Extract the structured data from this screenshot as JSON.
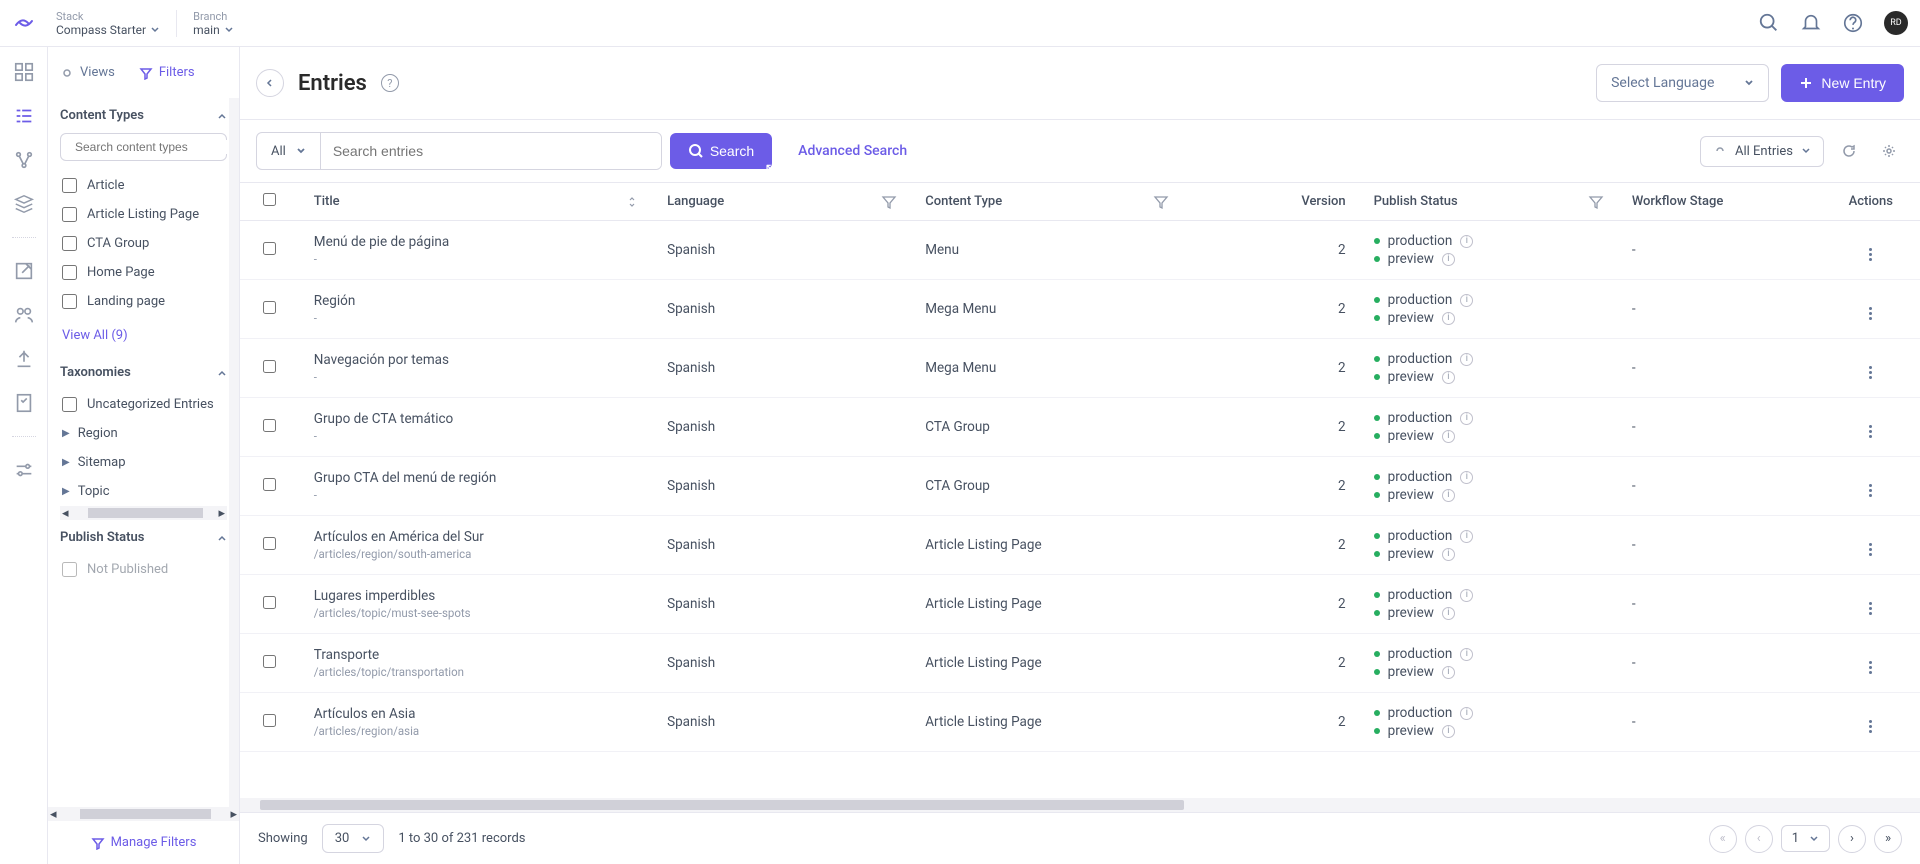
{
  "colors": {
    "accent": "#6c5ce7",
    "green": "#27ae60"
  },
  "topbar": {
    "stack_label": "Stack",
    "stack_value": "Compass Starter",
    "branch_label": "Branch",
    "branch_value": "main",
    "avatar": "RD"
  },
  "sidebar": {
    "views_label": "Views",
    "filters_label": "Filters",
    "content_types_label": "Content Types",
    "search_placeholder": "Search content types",
    "content_types": [
      "Article",
      "Article Listing Page",
      "CTA Group",
      "Home Page",
      "Landing page"
    ],
    "view_all_label": "View All (9)",
    "taxonomies_label": "Taxonomies",
    "uncategorized_label": "Uncategorized Entries",
    "taxonomies": [
      "Region",
      "Sitemap",
      "Topic"
    ],
    "publish_status_label": "Publish Status",
    "not_published_label": "Not Published",
    "manage_filters_label": "Manage Filters"
  },
  "header": {
    "title": "Entries",
    "lang_select": "Select Language",
    "new_entry": "New Entry"
  },
  "search": {
    "all_label": "All",
    "placeholder": "Search entries",
    "search_btn": "Search",
    "advanced": "Advanced Search",
    "all_entries": "All Entries"
  },
  "columns": {
    "title": "Title",
    "language": "Language",
    "content_type": "Content Type",
    "version": "Version",
    "publish_status": "Publish Status",
    "workflow_stage": "Workflow Stage",
    "actions": "Actions"
  },
  "status": {
    "production": "production",
    "preview": "preview",
    "dash": "-"
  },
  "rows": [
    {
      "title": "Menú de pie de página",
      "sub": "-",
      "lang": "Spanish",
      "ct": "Menu",
      "ver": "2"
    },
    {
      "title": "Región",
      "sub": "-",
      "lang": "Spanish",
      "ct": "Mega Menu",
      "ver": "2"
    },
    {
      "title": "Navegación por temas",
      "sub": "-",
      "lang": "Spanish",
      "ct": "Mega Menu",
      "ver": "2"
    },
    {
      "title": "Grupo de CTA temático",
      "sub": "-",
      "lang": "Spanish",
      "ct": "CTA Group",
      "ver": "2"
    },
    {
      "title": "Grupo CTA del menú de región",
      "sub": "-",
      "lang": "Spanish",
      "ct": "CTA Group",
      "ver": "2"
    },
    {
      "title": "Artículos en América del Sur",
      "sub": "/articles/region/south-america",
      "lang": "Spanish",
      "ct": "Article Listing Page",
      "ver": "2"
    },
    {
      "title": "Lugares imperdibles",
      "sub": "/articles/topic/must-see-spots",
      "lang": "Spanish",
      "ct": "Article Listing Page",
      "ver": "2"
    },
    {
      "title": "Transporte",
      "sub": "/articles/topic/transportation",
      "lang": "Spanish",
      "ct": "Article Listing Page",
      "ver": "2"
    },
    {
      "title": "Artículos en Asia",
      "sub": "/articles/region/asia",
      "lang": "Spanish",
      "ct": "Article Listing Page",
      "ver": "2"
    }
  ],
  "footer": {
    "showing": "Showing",
    "page_size": "30",
    "range": "1 to 30 of 231 records",
    "page": "1"
  }
}
